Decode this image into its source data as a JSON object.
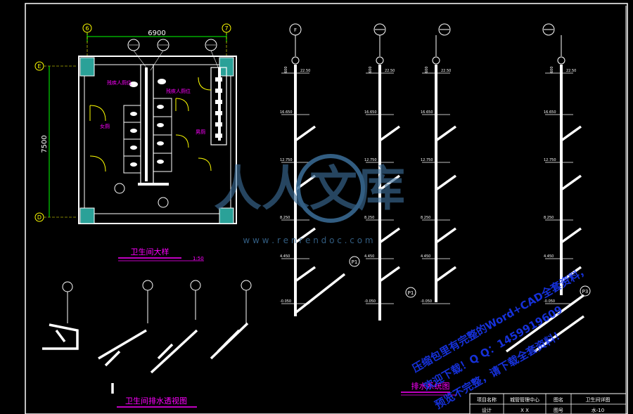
{
  "drawing": {
    "bathroom_plan_title": "卫生间大样",
    "plan_scale": "1:50",
    "drainage_axonometric_title": "卫生间排水透视图",
    "drainage_system_title": "排水系统图",
    "dim_horizontal": "6900",
    "dim_vertical": "7500",
    "axis_labels": {
      "col_left": "6",
      "col_right": "7",
      "row_top": "E",
      "row_bottom": "D"
    },
    "room_labels": {
      "women": "女厕",
      "men": "男厕",
      "disabled_women": "残疾人厕位",
      "disabled_men": "残疾人厕位"
    },
    "riser_tags": [
      "F",
      "W\n1",
      "W\n2",
      "W\n3"
    ],
    "pipe_tags": [
      "P1",
      "P1",
      "P3"
    ],
    "levels": [
      "22.50",
      "16.650",
      "12.750",
      "8.250",
      "4.450",
      "-0.050"
    ],
    "level_markers": [
      "600"
    ]
  },
  "title_block": {
    "row1": [
      "项目名称",
      "城管管理中心",
      "图名",
      "卫生间详图"
    ],
    "row2": [
      "设计",
      "X X",
      "图号",
      "水-10"
    ]
  },
  "watermark": {
    "brand_text": "人人文库",
    "url_text": "w w w . r e n r e n d o c . c o m",
    "lines": [
      "压缩包里有完整的Word+CAD全套资料，",
      "欢迎下载！Q Q：1459919609",
      "预览不完整，请下载全套资料！"
    ]
  },
  "colors": {
    "background": "#000000",
    "lines": "#ffffff",
    "wall_hatch": "#2aa198",
    "axis_bubble": "#ffff00",
    "dim": "#00ff00",
    "label_magenta": "#ff00ff",
    "pipe": "#ffffff",
    "watermark_blue": "#1a3aff",
    "watermark_logo": "#3c6e99"
  }
}
